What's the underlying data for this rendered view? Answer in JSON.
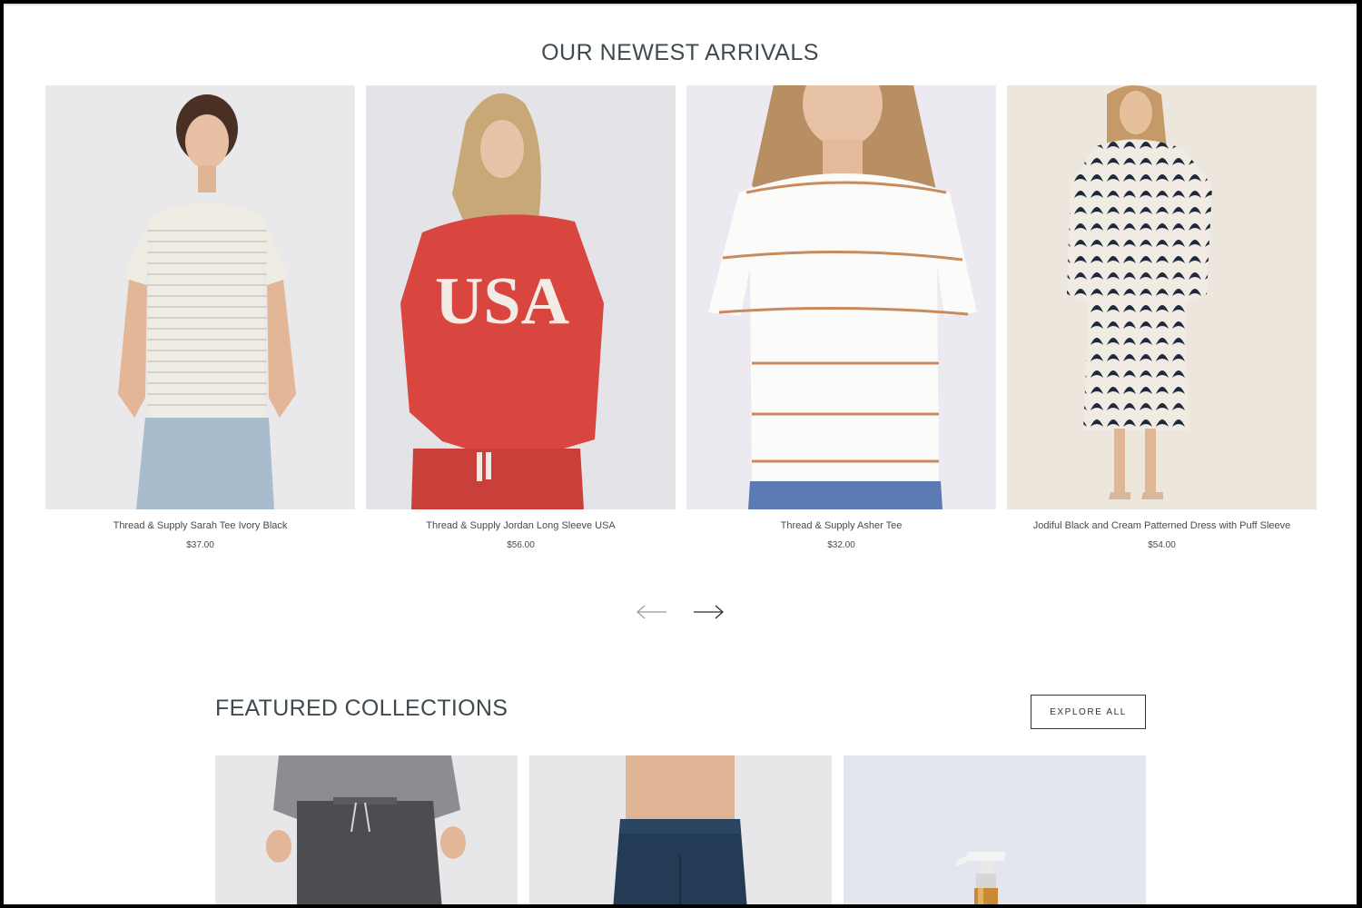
{
  "new_arrivals": {
    "title": "OUR NEWEST ARRIVALS",
    "products": [
      {
        "name": "Thread & Supply Sarah Tee Ivory Black",
        "price": "$37.00"
      },
      {
        "name": "Thread & Supply Jordan Long Sleeve USA",
        "price": "$56.00"
      },
      {
        "name": "Thread & Supply Asher Tee",
        "price": "$32.00"
      },
      {
        "name": "Jodiful Black and Cream Patterned Dress with Puff Sleeve",
        "price": "$54.00"
      }
    ],
    "prev_icon": "arrow-left-icon",
    "next_icon": "arrow-right-icon",
    "sweatshirt_print": "USA"
  },
  "featured": {
    "title": "FEATURED COLLECTIONS",
    "explore_label": "EXPLORE ALL"
  },
  "colors": {
    "heading": "#3f4a4f",
    "button_border": "#2e3337",
    "sweatshirt_red": "#d9463f",
    "stripe_tan": "#c98a5e"
  }
}
